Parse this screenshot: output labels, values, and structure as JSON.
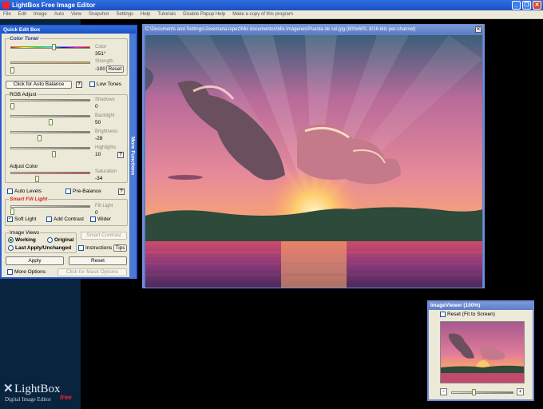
{
  "window": {
    "title": "LightBox Free Image Editor",
    "controls": {
      "minimize": "_",
      "restore": "❐",
      "close": "✕"
    }
  },
  "menu": [
    "File",
    "Edit",
    "Image",
    "Auto",
    "View",
    "Snapshot",
    "Settings",
    "Help",
    "Tutorials",
    "Disable Popup Help",
    "Make a copy of this program"
  ],
  "quick_edit": {
    "title": "Quick Edit Box",
    "side_tab": "More Functions",
    "color_toner": {
      "label": "Color Toner",
      "color_label": "Color",
      "color_value": "351°",
      "color_level": 0.55,
      "strength_label": "Strength",
      "strength_value": "-100",
      "strength_level": 0.0,
      "reset_label": "Reset"
    },
    "auto_balance_label": "Click for Auto Balance",
    "help_mark": "?",
    "low_tones_label": "Low Tones",
    "rgb_adjust": {
      "label": "RGB Adjust",
      "shadows_label": "Shadows",
      "shadows_value": "0",
      "shadows_level": 0.0,
      "backlight_label": "Backlight",
      "backlight_value": "50",
      "backlight_level": 0.5,
      "brightness_label": "Brightness",
      "brightness_value": "-28",
      "brightness_level": 0.36,
      "highlights_label": "Highlights",
      "highlights_value": "10",
      "highlights_level": 0.55
    },
    "adjust_color": {
      "label": "Adjust Color",
      "saturation_label": "Saturation",
      "saturation_value": "-34",
      "saturation_level": 0.33
    },
    "auto_levels_label": "Auto Levels",
    "pre_balance_label": "Pre-Balance",
    "smart_fill": {
      "label": "Smart Fill Light",
      "fill_label": "Fill Light",
      "fill_value": "0",
      "fill_level": 0.0,
      "soft_light_label": "Soft Light",
      "soft_light_checked": true,
      "add_contrast_label": "Add Contrast",
      "wider_label": "Wider"
    },
    "image_views": {
      "label": "Image Views",
      "working_label": "Working",
      "original_label": "Original",
      "last_apply_label": "Last Apply/Unchanged"
    },
    "smart_contrast_label": "Smart Contrast",
    "instructions_label": "Instructions",
    "tips_label": "Tips",
    "apply_label": "Apply",
    "reset_label": "Reset",
    "more_options_label": "More Options",
    "mask_options_label": "Click for Mask Options"
  },
  "image_window": {
    "title": "C:\\Documents and Settings\\Josemaria.lopez\\Mis documentos\\Mis imágenes\\Puesta de sol.jpg  (800x600, 8/16-bits per-channel)",
    "close": "✕"
  },
  "image_viewer": {
    "title": "ImageViewer (100%)",
    "reset_label": "Reset (Fit to Screen)",
    "zoom_out": "-",
    "zoom_in": "+",
    "zoom_level": 0.35
  },
  "brand": {
    "name": "LightBox",
    "subtitle": "Digital Image Editor",
    "badge": "free"
  }
}
